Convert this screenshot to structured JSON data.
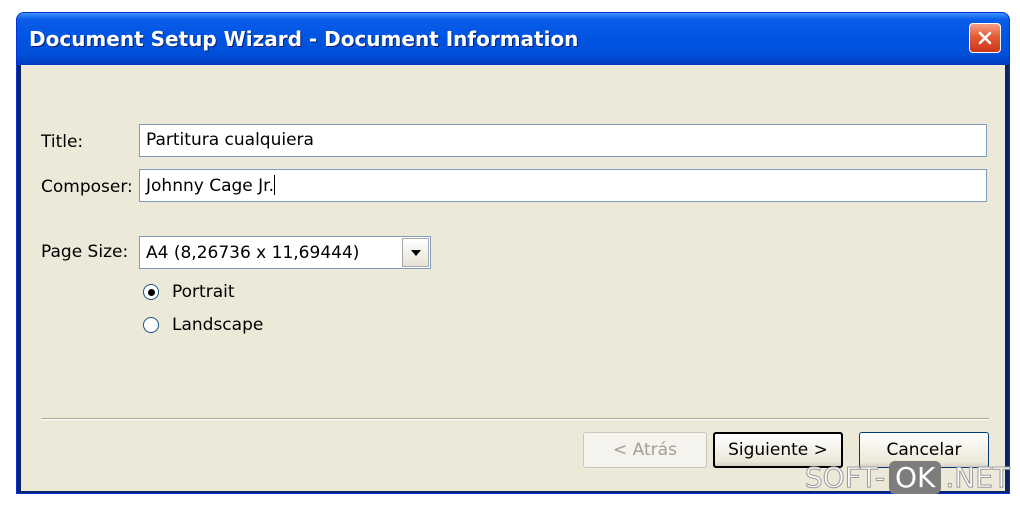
{
  "window": {
    "title": "Document Setup Wizard - Document Information"
  },
  "form": {
    "title_label": "Title:",
    "title_value": "Partitura cualquiera",
    "composer_label": "Composer:",
    "composer_value": "Johnny Cage Jr.",
    "page_size_label": "Page Size:",
    "page_size_value": "A4 (8,26736 x 11,69444)",
    "orientation": {
      "selected": "Portrait",
      "options": [
        "Portrait",
        "Landscape"
      ]
    }
  },
  "buttons": {
    "back": "< Atrás",
    "next": "Siguiente >",
    "cancel": "Cancelar"
  },
  "watermark": {
    "part1": "SOFT-",
    "part2": "OK",
    "part3": ".NET"
  },
  "icons": {
    "close": "close-icon",
    "dropdown": "chevron-down-icon"
  },
  "colors": {
    "titlebar": "#0054e3",
    "client_bg": "#ece9d8",
    "close_button": "#e45b33"
  }
}
